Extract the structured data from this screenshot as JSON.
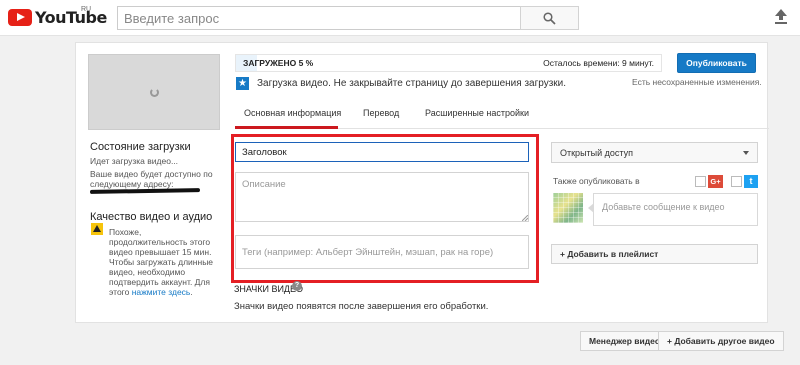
{
  "header": {
    "logo_text": "YouTube",
    "logo_region": "RU",
    "search_placeholder": "Введите запрос"
  },
  "upload": {
    "progress_label": "ЗАГРУЖЕНО 5 %",
    "progress_fraction": 0.05,
    "time_left": "Осталось времени: 9 минут.",
    "publish_label": "Опубликовать",
    "unsaved_label": "Есть несохраненные изменения.",
    "upload_message": "Загрузка видео. Не закрывайте страницу до завершения загрузки."
  },
  "tabs": [
    {
      "label": "Основная информация",
      "active": true
    },
    {
      "label": "Перевод",
      "active": false
    },
    {
      "label": "Расширенные настройки",
      "active": false
    }
  ],
  "status": {
    "heading": "Состояние загрузки",
    "line1": "Идет загрузка видео...",
    "line2": "Ваше видео будет доступно по",
    "line3": "следующему адресу:"
  },
  "quality": {
    "heading": "Качество видео и аудио",
    "lines": [
      "Похоже,",
      "продолжительность этого",
      "видео превышает 15 мин.",
      "Чтобы загружать длинные",
      "видео, необходимо",
      "подтвердить аккаунт. Для"
    ],
    "last_prefix": "этого ",
    "link_text": "нажмите здесь",
    "last_suffix": "."
  },
  "form": {
    "title_value": "Заголовок",
    "description_placeholder": "Описание",
    "tags_placeholder": "Теги (например: Альберт Эйнштейн, мэшап, рак на горе)"
  },
  "thumbnails": {
    "heading": "ЗНАЧКИ ВИДЕО",
    "help_glyph": "?",
    "text": "Значки видео появятся после завершения его обработки."
  },
  "sidebar_right": {
    "privacy_value": "Открытый доступ",
    "also_publish_label": "Также опубликовать в",
    "gplus_label": "G+",
    "twitter_label": "t",
    "share_placeholder": "Добавьте сообщение к видео",
    "playlist_label": "+ Добавить в плейлист"
  },
  "footer": {
    "manager_label": "Менеджер видео",
    "add_other_label": "+ Добавить другое видео"
  },
  "colors": {
    "brand_red": "#e62117",
    "accent_blue": "#167ac6",
    "highlight_frame": "#e41f24"
  }
}
